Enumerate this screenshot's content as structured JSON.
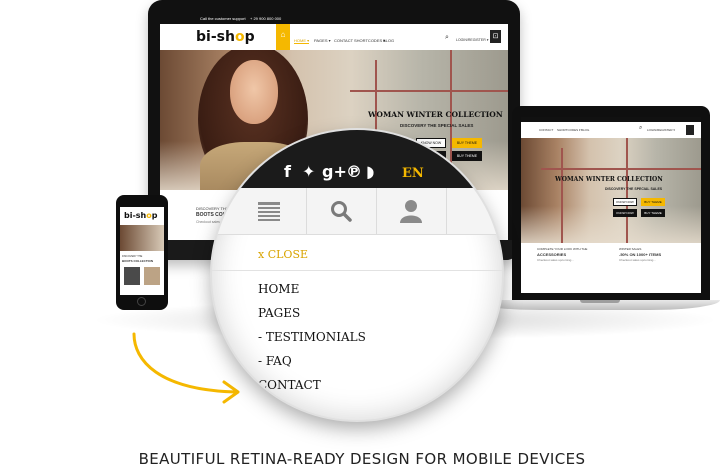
{
  "desktop": {
    "topbar_support": "Call the customer support",
    "topbar_phone": "+ 29 900 800 000",
    "logo": {
      "pre": "bi-sh",
      "o": "o",
      "post": "p"
    },
    "nav": [
      "HOME ▾",
      "PAGES ▾",
      "CONTACT",
      "SHORTCODES ▾",
      "BLOG"
    ],
    "login": "LOGIN/REGISTER ▾",
    "hero_title": "WOMAN WINTER COLLECTION",
    "hero_subtitle": "DISCOVERY THE SPECIAL SALES",
    "btn_know_now": "KNOW NOW",
    "btn_buy_theme": "BUY THEME",
    "promo_line1": "DISCOVERY THE",
    "promo_line2": "BOOTS COLLECTION",
    "promo_body": "Checkout sales upcoming..."
  },
  "laptop": {
    "hero_title": "WOMAN WINTER COLLECTION",
    "hero_subtitle": "DISCOVERY THE SPECIAL SALES",
    "btn_know_now": "KNOW NOW",
    "btn_buy_theme": "BUY THEME",
    "promo_a1": "COMPLETE YOUR LOOK WITH THE",
    "promo_a2": "ACCESSORIES",
    "promo_a3": "Checkout sales upcoming...",
    "promo_b1": "WINTER SALES",
    "promo_b2": "-50% ON 1000+ ITEMS",
    "promo_b3": "Checkout sales upcoming..."
  },
  "phone": {
    "logo": {
      "pre": "bi-sh",
      "o": "o",
      "post": "p"
    },
    "promo_line1": "DISCOVERY THE",
    "promo_line2": "BOOTS COLLECTION"
  },
  "magnifier": {
    "language": "EN",
    "close_label": "x CLOSE",
    "menu": [
      "HOME",
      "PAGES",
      " - TESTIMONIALS",
      "- FAQ",
      "CONTACT"
    ]
  },
  "caption": "BEAUTIFUL RETINA-READY DESIGN FOR MOBILE DEVICES",
  "colors": {
    "accent": "#f5b800",
    "dark": "#111111"
  }
}
